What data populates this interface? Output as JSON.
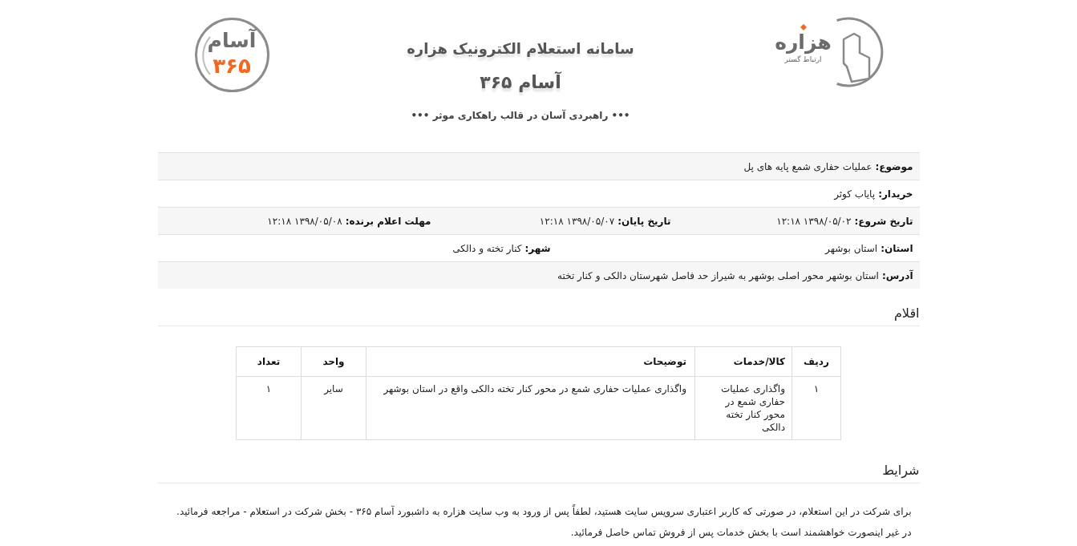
{
  "header": {
    "brand_logo": {
      "wordmark": "هزاره",
      "tagline": "ارتباط گستر"
    },
    "titles": [
      "سامانه استعلام الکترونیک هزاره",
      "آسام ۳۶۵",
      "••• راهبردی آسان در قالب راهکاری موثر •••"
    ],
    "product_logo": {
      "name": "آسام",
      "number": "۳۶۵"
    }
  },
  "info": [
    {
      "fields": [
        {
          "label": "موضوع:",
          "value": "عملیات حفاری شمع پایه های پل"
        }
      ]
    },
    {
      "fields": [
        {
          "label": "خریدار:",
          "value": "پایاب کوثر"
        }
      ]
    },
    {
      "fields": [
        {
          "label": "تاریخ شروع:",
          "value": "۱۳۹۸/۰۵/۰۲ ۱۲:۱۸"
        },
        {
          "label": "تاریخ پایان:",
          "value": "۱۳۹۸/۰۵/۰۷ ۱۲:۱۸"
        },
        {
          "label": "مهلت اعلام برنده:",
          "value": "۱۳۹۸/۰۵/۰۸ ۱۲:۱۸"
        }
      ]
    },
    {
      "fields": [
        {
          "label": "استان:",
          "value": "استان بوشهر"
        },
        {
          "label": "شهر:",
          "value": "کنار تخته و دالکی"
        }
      ]
    },
    {
      "fields": [
        {
          "label": "آدرس:",
          "value": "استان بوشهر محور اصلی بوشهر به شیراز حد فاصل شهرستان دالکی و کنار تخته"
        }
      ]
    }
  ],
  "items": {
    "title": "اقلام",
    "columns": [
      "ردیف",
      "کالا/خدمات",
      "توضیحات",
      "واحد",
      "تعداد"
    ],
    "rows": [
      [
        "۱",
        "واگذاری عملیات حفاری شمع در محور کنار تخته دالکی",
        "واگذاری عملیات حفاری شمع در محور کنار تخته دالکی واقع در استان بوشهر",
        "سایر",
        "۱"
      ]
    ]
  },
  "terms": {
    "title": "شرایط",
    "paragraphs": [
      "برای شرکت در این استعلام، در صورتی که کاربر اعتباری سرویس سایت هستید، لطفاً پس از ورود به وب سایت هزاره به داشبورد آسام ۳۶۵ - بخش شرکت در استعلام - مراجعه فرمائید.",
      "در غیر اینصورت خواهشمند است با بخش خدمات پس از فروش تماس حاصل فرمائید."
    ]
  }
}
